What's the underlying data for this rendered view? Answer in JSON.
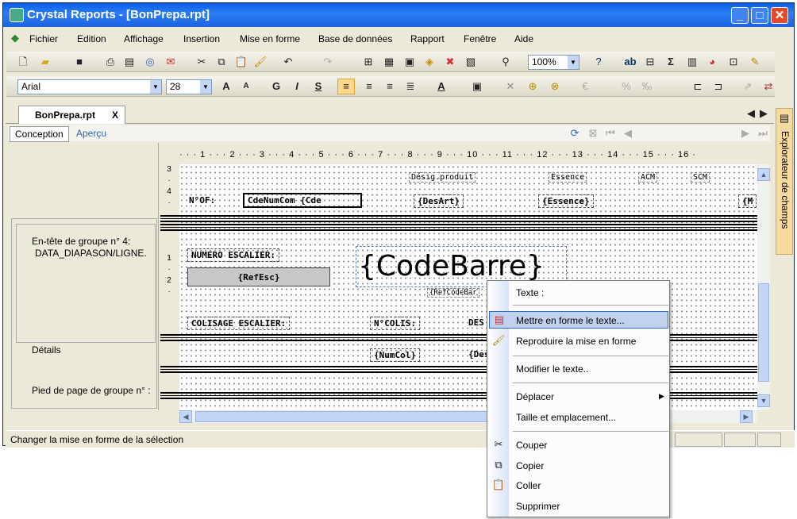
{
  "window": {
    "title": "Crystal Reports - [BonPrepa.rpt]"
  },
  "menu": [
    "Fichier",
    "Edition",
    "Affichage",
    "Insertion",
    "Mise en forme",
    "Base de données",
    "Rapport",
    "Fenêtre",
    "Aide"
  ],
  "toolbar": {
    "zoom": "100%",
    "font": "Arial",
    "size": "28"
  },
  "doc": {
    "tab": "BonPrepa.rpt",
    "close": "X",
    "conception": "Conception",
    "apercu": "Aperçu"
  },
  "sidebar": {
    "label": "Explorateur de champs"
  },
  "sections": {
    "group_header": "En-tête de groupe n° 4:",
    "group_header_field": "DATA_DIAPASON/LIGNE.",
    "details": "Détails",
    "group_footer": "Pied de page de groupe n° :"
  },
  "report": {
    "h_designation": "Désig.produit",
    "h_essence": "Essence",
    "h_acm": "ACM",
    "h_scm": "SCM",
    "nof": "N°OF:",
    "cdenumcom": "CdeNumCom",
    "cde": "{Cde",
    "desart": "{DesArt}",
    "essence": "{Essence}",
    "w_m": "{M",
    "numero_escalier": "NUMERO ESCALIER:",
    "refesc": "{RefEsc}",
    "codebarre": "{CodeBarre}",
    "refcodebar": "{RefCodeBar",
    "colisage": "COLISAGE ESCALIER:",
    "ncolis": "N°COLIS:",
    "des": "DES",
    "numcol": "{NumCol}",
    "des2": "{Des"
  },
  "context_menu": {
    "texte": "Texte :",
    "mettre_en_forme": "Mettre en forme le texte...",
    "reproduire": "Reproduire la mise en forme",
    "modifier": "Modifier le texte..",
    "deplacer": "Déplacer",
    "taille": "Taille et emplacement...",
    "couper": "Couper",
    "copier": "Copier",
    "coller": "Coller",
    "supprimer": "Supprimer"
  },
  "status": {
    "text": "Changer la mise en forme de la sélection"
  },
  "colors": {
    "title": "#1c64e0",
    "highlight": "#c1d2ee",
    "section_bg": "#ece9d8"
  }
}
